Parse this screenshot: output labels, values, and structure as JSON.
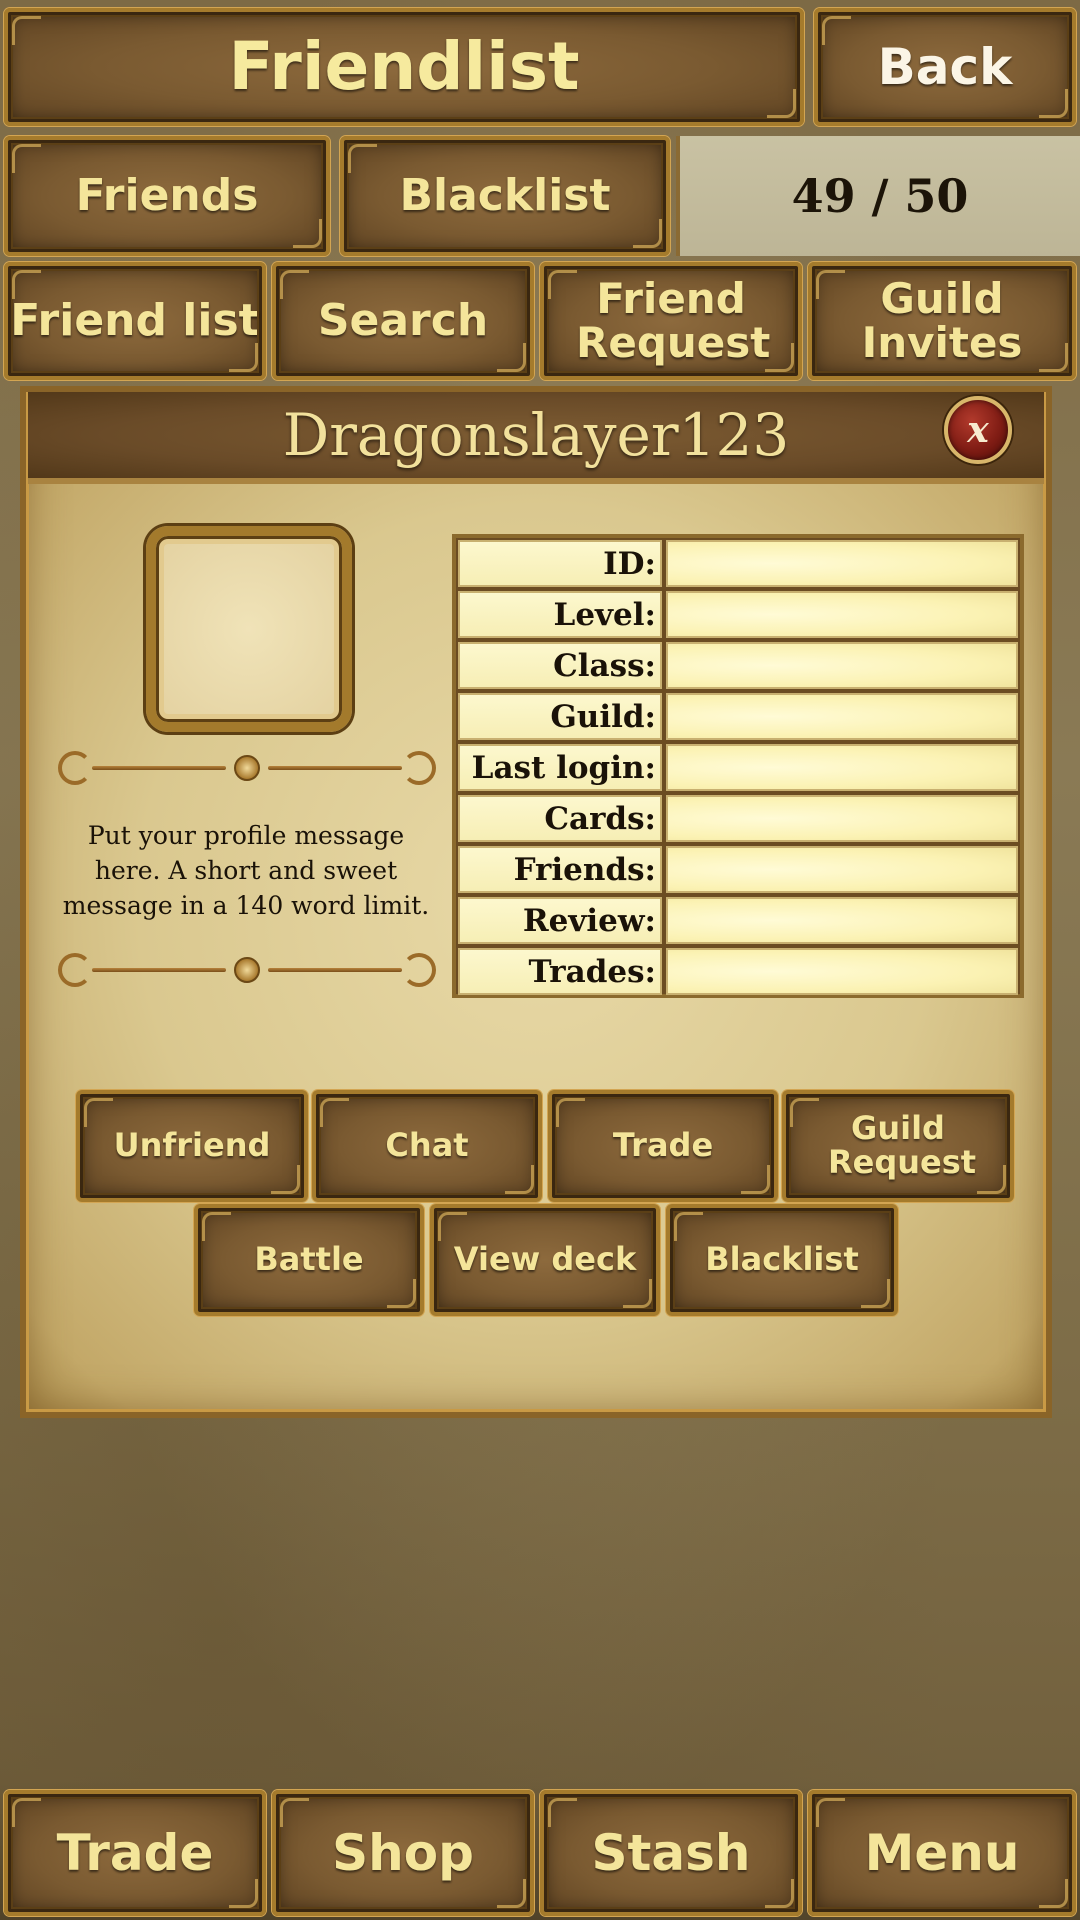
{
  "header": {
    "title": "Friendlist",
    "back_label": "Back"
  },
  "tabs": {
    "friends": "Friends",
    "blacklist": "Blacklist",
    "count": "49 / 50"
  },
  "subtabs": {
    "friend_list": "Friend list",
    "search": "Search",
    "friend_request": "Friend Request",
    "guild_invites": "Guild Invites"
  },
  "profile": {
    "username": "Dragonslayer123",
    "close_label": "x",
    "message": "Put your profile message here. A short and sweet message in a 140 word limit.",
    "fields": [
      {
        "label": "ID:",
        "value": ""
      },
      {
        "label": "Level:",
        "value": ""
      },
      {
        "label": "Class:",
        "value": ""
      },
      {
        "label": "Guild:",
        "value": ""
      },
      {
        "label": "Last login:",
        "value": ""
      },
      {
        "label": "Cards:",
        "value": ""
      },
      {
        "label": "Friends:",
        "value": ""
      },
      {
        "label": "Review:",
        "value": ""
      },
      {
        "label": "Trades:",
        "value": ""
      }
    ],
    "actions_row1": [
      "Unfriend",
      "Chat",
      "Trade",
      "Guild Request"
    ],
    "actions_row2": [
      "Battle",
      "View deck",
      "Blacklist"
    ]
  },
  "bottom_nav": {
    "items": [
      "Trade",
      "Shop",
      "Stash",
      "Menu"
    ]
  },
  "colors": {
    "gold_text": "#f4e59a",
    "wood": "#7a5a31",
    "frame_gold": "#a57b2c",
    "parchment": "#dac88f",
    "close_red": "#7f1c14"
  }
}
